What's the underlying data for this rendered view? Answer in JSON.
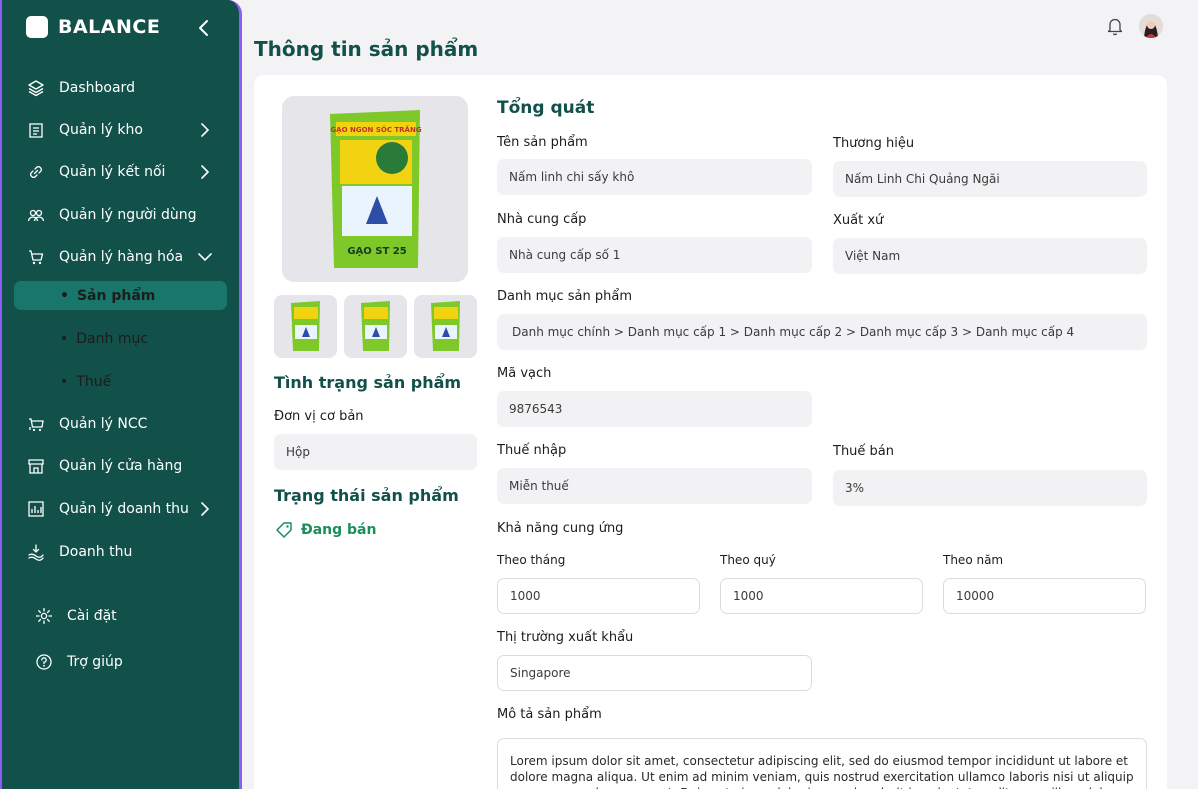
{
  "brand": {
    "name": "BALANCE"
  },
  "sidebar": {
    "items": [
      {
        "label": "Dashboard",
        "icon": "layers-icon"
      },
      {
        "label": "Quản lý kho",
        "icon": "warehouse-icon"
      },
      {
        "label": "Quản lý kết nối",
        "icon": "link-icon"
      },
      {
        "label": "Quản lý người dùng",
        "icon": "users-icon"
      },
      {
        "label": "Quản lý hàng hóa",
        "icon": "cart-icon"
      },
      {
        "label": "Quản lý NCC",
        "icon": "supplier-icon"
      },
      {
        "label": "Quản lý cửa hàng",
        "icon": "store-icon"
      },
      {
        "label": "Quản lý doanh thu",
        "icon": "chart-icon"
      },
      {
        "label": "Doanh thu",
        "icon": "money-icon"
      }
    ],
    "sub_items": [
      {
        "label": "Sản phẩm",
        "active": true
      },
      {
        "label": "Danh mục",
        "active": false
      },
      {
        "label": "Thuế",
        "active": false
      }
    ],
    "bottom": [
      {
        "label": "Cài đặt",
        "icon": "gear-icon"
      },
      {
        "label": "Trợ giúp",
        "icon": "help-icon"
      }
    ],
    "bullet": "•"
  },
  "header": {
    "title": "Thông tin sản phẩm"
  },
  "left_panel": {
    "status_title": "Tình trạng sản phẩm",
    "unit_label": "Đơn vị cơ bản",
    "unit_value": "Hộp",
    "state_title": "Trạng thái sản phẩm",
    "state_value": "Đang bán"
  },
  "product_image": {
    "brand_text": "GẠO ST 25",
    "top_text": "GẠO NGON SÓC TRĂNG"
  },
  "general": {
    "title": "Tổng quát",
    "name_label": "Tên sản phẩm",
    "name_value": "Nấm linh chi sấy khô",
    "brand_label": "Thương hiệu",
    "brand_value": "Nấm Linh Chi Quảng Ngãi",
    "supplier_label": "Nhà cung cấp",
    "supplier_value": "Nhà cung cấp số 1",
    "origin_label": "Xuất xứ",
    "origin_value": "Việt Nam",
    "category_label": "Danh mục sản phẩm",
    "category_value": "Danh mục chính > Danh mục cấp 1 > Danh mục cấp 2 > Danh mục cấp 3 > Danh mục cấp 4",
    "barcode_label": "Mã vạch",
    "barcode_value": "9876543",
    "import_tax_label": "Thuế nhập",
    "import_tax_value": "Miễn thuế",
    "sale_tax_label": "Thuế bán",
    "sale_tax_value": "3%",
    "supply_label": "Khả năng cung ứng",
    "month_label": "Theo tháng",
    "month_value": "1000",
    "quarter_label": "Theo quý",
    "quarter_value": "1000",
    "year_label": "Theo năm",
    "year_value": "10000",
    "export_label": "Thị trường xuất khẩu",
    "export_value": "Singapore",
    "desc_label": "Mô tả sản phẩm",
    "desc_value": "Lorem ipsum dolor sit amet, consectetur adipiscing elit, sed do eiusmod tempor incididunt ut labore et dolore magna aliqua. Ut enim ad minim veniam, quis nostrud exercitation ullamco laboris nisi ut aliquip ex ea commodo consequat. Duis aute irure dolor in reprehenderit in voluptate velit esse cillum dolore eu fugiat nulla pariatur."
  },
  "colors": {
    "sidebar": "#12504a",
    "active": "#19766b",
    "accent": "#12504a",
    "status": "#1b8f5a",
    "border": "#8b5cf6"
  }
}
